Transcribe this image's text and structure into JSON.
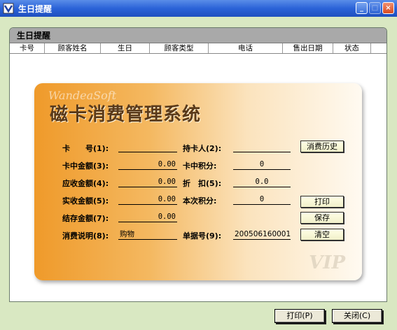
{
  "window": {
    "title": "生日提醒"
  },
  "panel": {
    "header": "生日提醒"
  },
  "columns": [
    "卡号",
    "顾客姓名",
    "生日",
    "顾客类型",
    "电话",
    "售出日期",
    "状态"
  ],
  "card": {
    "watermark": "WandeaSoft",
    "title": "磁卡消费管理系统",
    "vip": "VIP",
    "fields": {
      "card_no": {
        "label": "卡　　号(1):",
        "value": ""
      },
      "holder": {
        "label": "持卡人(2):",
        "value": ""
      },
      "card_amount": {
        "label": "卡中金额(3):",
        "value": "0.00"
      },
      "card_points": {
        "label": "卡中积分:",
        "value": "0"
      },
      "receivable": {
        "label": "应收金额(4):",
        "value": "0.00"
      },
      "discount": {
        "label": "折　扣(5):",
        "value": "0.0"
      },
      "paid": {
        "label": "实收金额(5):",
        "value": "0.00"
      },
      "this_points": {
        "label": "本次积分:",
        "value": "0"
      },
      "balance": {
        "label": "结存金额(7):",
        "value": "0.00"
      },
      "note": {
        "label": "消费说明(8):",
        "value": "购物"
      },
      "receipt": {
        "label": "单据号(9):",
        "value": "200506160001"
      }
    },
    "buttons": {
      "history": "消费历史",
      "print": "打印",
      "save": "保存",
      "clear": "清空"
    }
  },
  "footer": {
    "print": "打印(P)",
    "close": "关闭(C)"
  }
}
